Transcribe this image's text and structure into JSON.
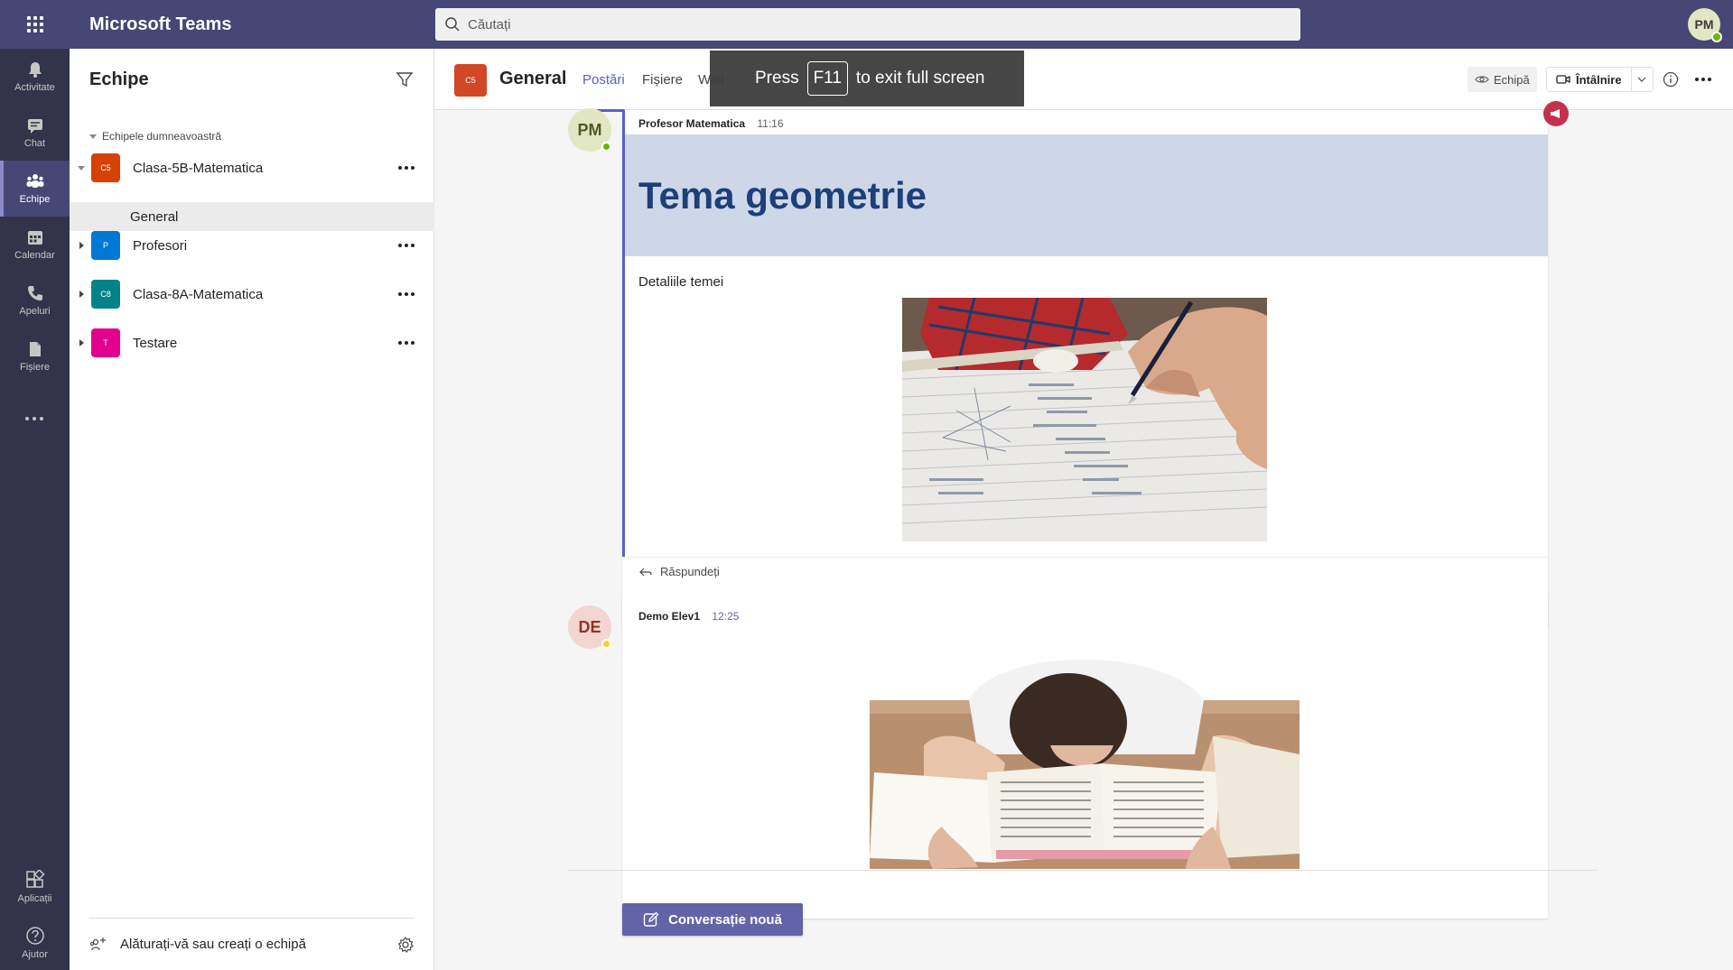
{
  "topbar": {
    "app_title": "Microsoft Teams",
    "search_placeholder": "Căutați",
    "user_initials": "PM"
  },
  "rail": {
    "items": [
      {
        "label": "Activitate",
        "icon": "bell-icon"
      },
      {
        "label": "Chat",
        "icon": "chat-icon"
      },
      {
        "label": "Echipe",
        "icon": "teams-icon",
        "active": true
      },
      {
        "label": "Calendar",
        "icon": "calendar-icon"
      },
      {
        "label": "Apeluri",
        "icon": "phone-icon"
      },
      {
        "label": "Fișiere",
        "icon": "file-icon"
      },
      {
        "label": "Aplicații",
        "icon": "apps-icon"
      },
      {
        "label": "Ajutor",
        "icon": "help-icon"
      }
    ]
  },
  "teams_panel": {
    "title": "Echipe",
    "section_label": "Echipele dumneavoastră",
    "teams": [
      {
        "initials": "C5",
        "name": "Clasa-5B-Matematica",
        "color": "#d74108",
        "expanded": true
      },
      {
        "initials": "P",
        "name": "Profesori",
        "color": "#0078d4"
      },
      {
        "initials": "C8",
        "name": "Clasa-8A-Matematica",
        "color": "#038387"
      },
      {
        "initials": "T",
        "name": "Testare",
        "color": "#e3008c"
      }
    ],
    "selected_channel": "General",
    "join_label": "Alăturați-vă sau creați o echipă"
  },
  "channel": {
    "team_initials": "C5",
    "name": "General",
    "tabs": [
      "Postări",
      "Fișiere",
      "Wiki"
    ],
    "active_tab": "Postări",
    "team_button": "Echipă",
    "meet_button": "Întâlnire"
  },
  "fullscreen_toast": {
    "press": "Press",
    "key": "F11",
    "rest": "to exit full screen"
  },
  "posts": [
    {
      "initials": "PM",
      "author": "Profesor Matematica",
      "time": "11:16",
      "headline": "Tema geometrie",
      "body": "Detaliile temei",
      "reply_label": "Răspundeți",
      "image": "student-writing-geometry-photo",
      "avatar_color": "#e3e6c3",
      "avatar_text_color": "#4e5a26"
    },
    {
      "initials": "DE",
      "author": "Demo Elev1",
      "time": "12:25",
      "image": "student-sleeping-on-books-photo",
      "avatar_color": "#f4d6d0",
      "avatar_text_color": "#8f3426"
    }
  ],
  "compose": {
    "new_conversation_label": "Conversație nouă"
  },
  "colors": {
    "brand": "#464775",
    "rail": "#33344a",
    "accent": "#6264a7",
    "presence_available": "#6bb700",
    "presence_away": "#f8d22a"
  }
}
